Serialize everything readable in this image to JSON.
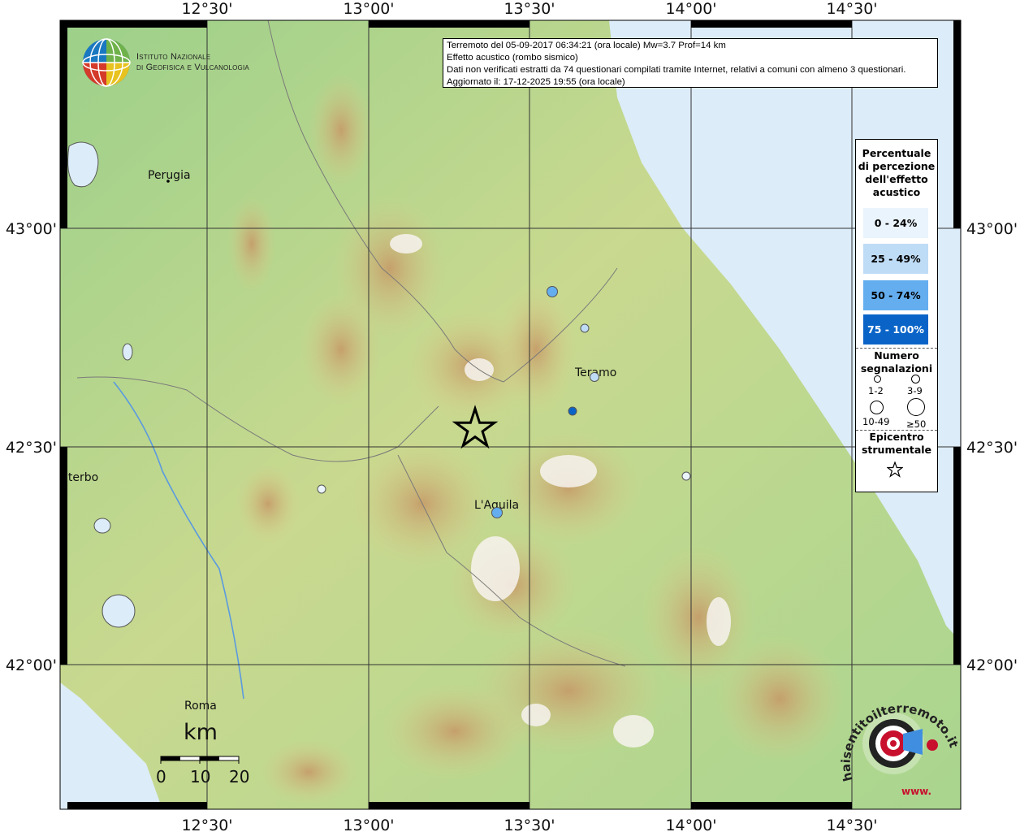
{
  "header": {
    "line1": "Terremoto del 05-09-2017 06:34:21 (ora locale) Mw=3.7 Prof=14 km",
    "line2": "Effetto acustico (rombo sismico)",
    "line3": "Dati non verificati estratti da 74 questionari compilati tramite Internet, relativi a comuni con almeno 3 questionari.",
    "line4": "Aggiornato il: 17-12-2025 19:55 (ora locale)"
  },
  "institute": {
    "line1": "Istituto Nazionale",
    "line2": "di Geofisica e Vulcanologia"
  },
  "axes": {
    "top": [
      "12°30'",
      "13°00'",
      "13°30'",
      "14°00'",
      "14°30'"
    ],
    "bottom": [
      "12°30'",
      "13°00'",
      "13°30'",
      "14°00'",
      "14°30'"
    ],
    "left": [
      "43°00'",
      "42°30'",
      "42°00'"
    ],
    "right": [
      "43°00'",
      "42°30'",
      "42°00'"
    ]
  },
  "cities": {
    "perugia": "Perugia",
    "teramo": "Teramo",
    "laquila": "L'Aquila",
    "viterbo": "iterbo",
    "roma": "Roma"
  },
  "legend": {
    "title": [
      "Percentuale",
      "di percezione",
      "dell'effetto",
      "acustico"
    ],
    "classes": [
      {
        "label": "0 - 24%",
        "color": "#eaf4fc"
      },
      {
        "label": "25 - 49%",
        "color": "#bfdcf6"
      },
      {
        "label": "50 - 74%",
        "color": "#64aef0"
      },
      {
        "label": "75 - 100%",
        "color": "#0a64c8"
      }
    ],
    "count_title": [
      "Numero",
      "segnalazioni"
    ],
    "counts": [
      "1-2",
      "3-9",
      "10-49",
      "≥50"
    ],
    "epicenter_title": [
      "Epicentro",
      "strumentale"
    ]
  },
  "scalebar": {
    "unit": "km",
    "ticks": [
      "0",
      "10",
      "20"
    ]
  },
  "watermark": {
    "text": "haisentitoilterremoto.it",
    "url": "www."
  },
  "colors": {
    "sea": "#dcecf8",
    "lowland": "#9fd28e",
    "hills": "#d8d98e",
    "mountains": "#b99060",
    "peaks": "#f7f3f0"
  }
}
